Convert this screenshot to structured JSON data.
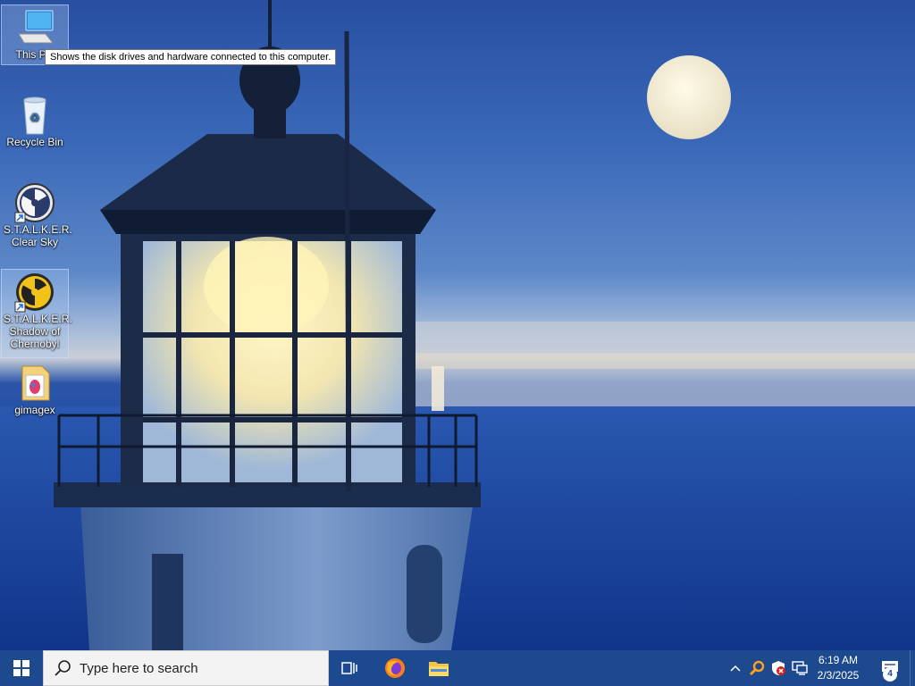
{
  "desktop": {
    "icons": [
      {
        "name": "This PC",
        "label": "This PC",
        "selected": true
      },
      {
        "name": "Recycle Bin",
        "label": "Recycle Bin"
      },
      {
        "name": "stalker-clear-sky",
        "label": "S.T.A.L.K.E.R. Clear Sky"
      },
      {
        "name": "stalker-shadow-of-chernobyl",
        "label": "S.T.A.L.K.E.R. Shadow of Chernobyl",
        "selected": true
      },
      {
        "name": "gimagex",
        "label": "gimagex"
      }
    ],
    "tooltip": "Shows the disk drives and hardware connected to this computer."
  },
  "taskbar": {
    "start_icon": "windows-logo-icon",
    "search_placeholder": "Type here to search",
    "apps": [
      {
        "name": "task-view",
        "icon": "task-view-icon"
      },
      {
        "name": "firefox",
        "icon": "firefox-icon"
      },
      {
        "name": "file-explorer",
        "icon": "folder-icon"
      }
    ],
    "tray_icons": [
      "chevron-up-icon",
      "search-tool-icon",
      "security-shield-icon",
      "network-icon"
    ],
    "time": "6:19 AM",
    "date": "2/3/2025",
    "notification_count": "4",
    "color": "#1d4a8e"
  }
}
